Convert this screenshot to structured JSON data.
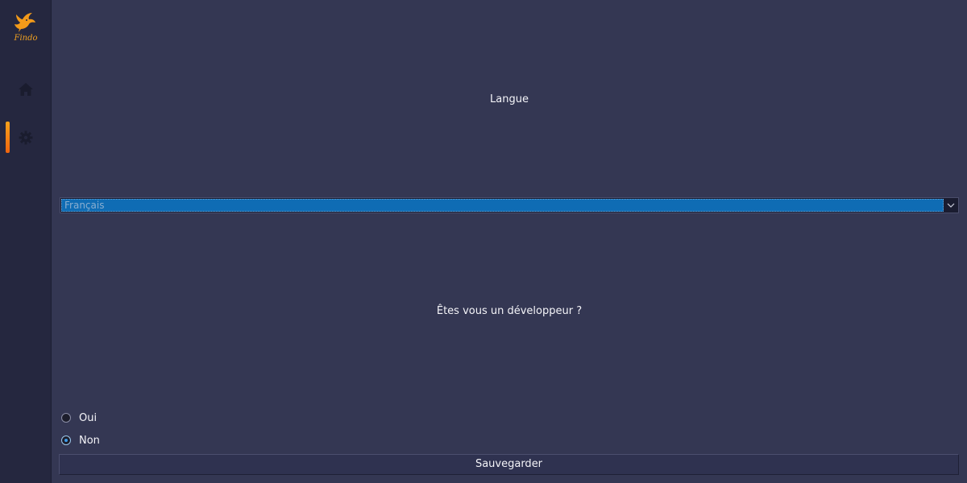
{
  "sidebar": {
    "logo_text": "Findo",
    "items": [
      {
        "icon": "home-icon",
        "active": false
      },
      {
        "icon": "gear-icon",
        "active": true
      }
    ],
    "accent_color": "#f7a21b"
  },
  "settings": {
    "language_label": "Langue",
    "language_selected": "Français",
    "developer_question": "Êtes vous un développeur ?",
    "options": [
      {
        "label": "Oui",
        "checked": false
      },
      {
        "label": "Non",
        "checked": true
      }
    ],
    "save_label": "Sauvegarder"
  },
  "colors": {
    "background": "#343753",
    "sidebar": "#25273f",
    "selection": "#0f6cb4",
    "radio_accent": "#3d9be9"
  }
}
